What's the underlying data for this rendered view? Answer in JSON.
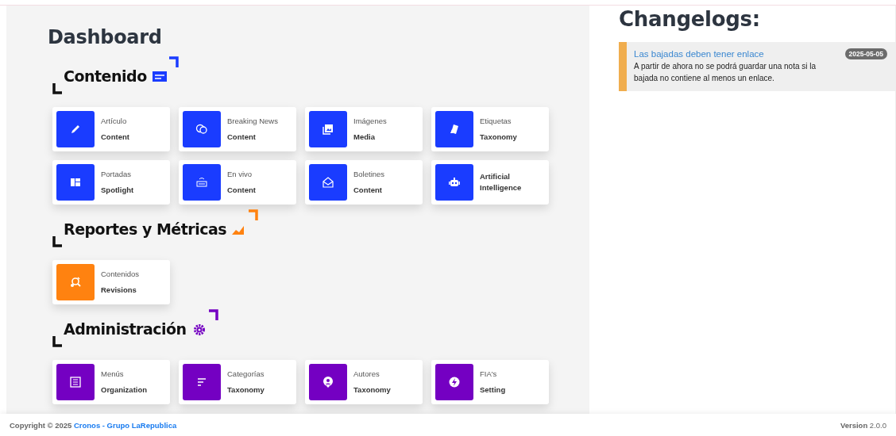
{
  "page": {
    "title": "Dashboard"
  },
  "sections": [
    {
      "title": "Contenido",
      "color": "#1a3cff",
      "cards": [
        {
          "name": "Artículo",
          "category": "Content"
        },
        {
          "name": "Breaking News",
          "category": "Content"
        },
        {
          "name": "Imágenes",
          "category": "Media"
        },
        {
          "name": "Etiquetas",
          "category": "Taxonomy"
        },
        {
          "name": "Portadas",
          "category": "Spotlight"
        },
        {
          "name": "En vivo",
          "category": "Content"
        },
        {
          "name": "Boletines",
          "category": "Content"
        },
        {
          "category": "Artificial Intelligence"
        }
      ]
    },
    {
      "title": "Reportes y Métricas",
      "color": "#ff8210",
      "cards": [
        {
          "name": "Contenidos",
          "category": "Revisions"
        }
      ]
    },
    {
      "title": "Administración",
      "color": "#7400c2",
      "cards": [
        {
          "name": "Menús",
          "category": "Organization"
        },
        {
          "name": "Categorías",
          "category": "Taxonomy"
        },
        {
          "name": "Autores",
          "category": "Taxonomy"
        },
        {
          "name": "FIA's",
          "category": "Setting"
        }
      ]
    }
  ],
  "changelog": {
    "title": "Changelogs:",
    "entries": [
      {
        "title": "Las bajadas deben tener enlace",
        "date": "2025-05-05",
        "description": "A partir de ahora no se podrá guardar una nota si la bajada no contiene al menos un enlace."
      }
    ]
  },
  "footer": {
    "copyright": "Copyright © 2025",
    "link": "Cronos - Grupo LaRepublica",
    "version": "**Version** 2.0.0"
  }
}
